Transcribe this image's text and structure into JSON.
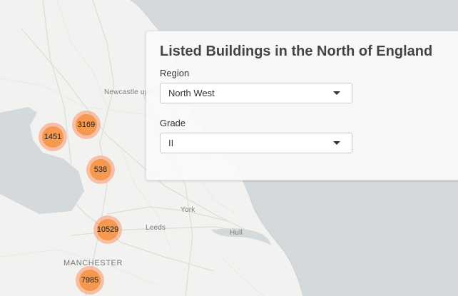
{
  "panel": {
    "title": "Listed Buildings in the North of England",
    "region_label": "Region",
    "region_value": "North West",
    "grade_label": "Grade",
    "grade_value": "II"
  },
  "map": {
    "places": {
      "newcastle": "Newcastle upon Tyne",
      "york": "York",
      "leeds": "Leeds",
      "hull": "Hull",
      "manchester": "MANCHESTER"
    },
    "clusters": [
      "1451",
      "3169",
      "538",
      "10529",
      "7985"
    ],
    "colors": {
      "sea": "#d4dadc",
      "land": "#f2f2f0",
      "cluster_outer": "#fd9c73",
      "cluster_inner": "#f18017"
    }
  }
}
